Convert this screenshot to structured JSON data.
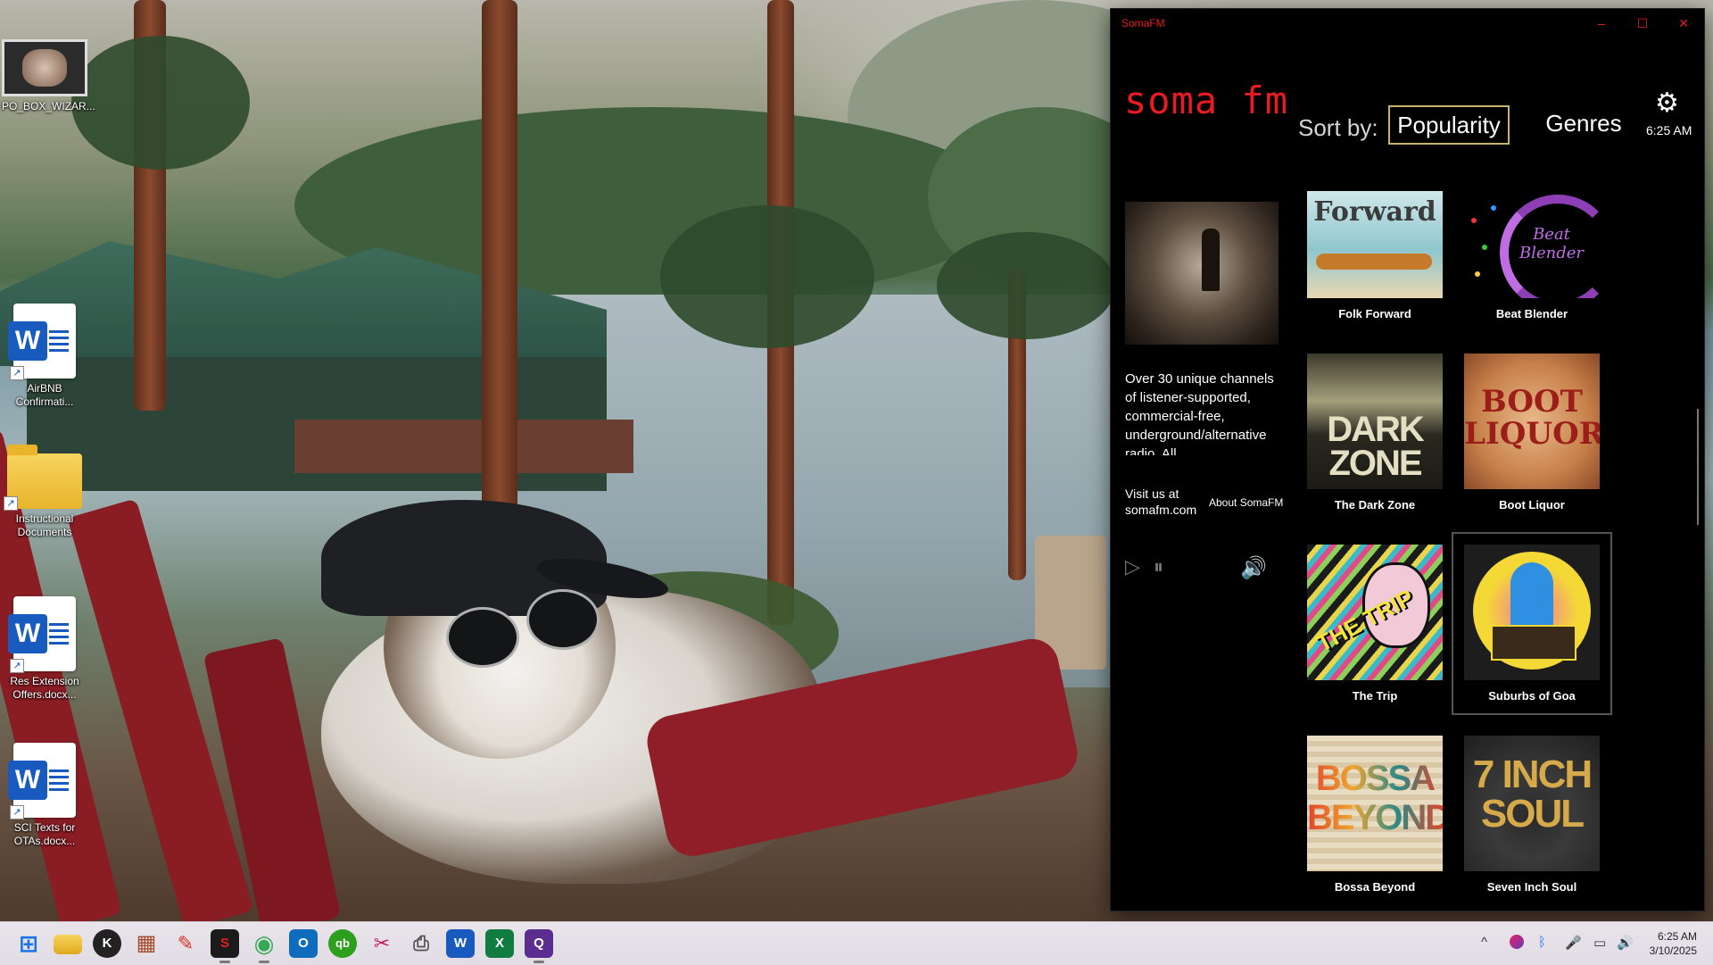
{
  "desktop": {
    "icons": [
      {
        "label": "PO_BOX_WIZAR..."
      },
      {
        "label": "AirBNB Confirmati..."
      },
      {
        "label": "Instructional Documents"
      },
      {
        "label": "Res Extension Offers.docx..."
      },
      {
        "label": "SCI Texts for OTAs.docx..."
      }
    ]
  },
  "window": {
    "title": "SomaFM",
    "controls": {
      "minimize": "–",
      "maximize": "☐",
      "close": "✕"
    }
  },
  "app": {
    "logo": "soma fm",
    "sort_label": "Sort by:",
    "sort_options": [
      "Popularity",
      "Genres"
    ],
    "selected_sort": "Popularity",
    "time": "6:25 AM",
    "description": "Over 30 unique channels of listener-supported, commercial-free, underground/alternative radio. All",
    "visit_text": "Visit us at somafm.com",
    "about_link": "About SomaFM",
    "icons": {
      "settings": "⚙",
      "play": "▷",
      "pause": "⏸",
      "volume": "🔊"
    }
  },
  "channels": [
    {
      "name": "Folk Forward",
      "art_text": "Forward"
    },
    {
      "name": "Beat Blender",
      "art_text": "Beat Blender"
    },
    {
      "name": "The Dark Zone",
      "art_text": "DARK ZONE"
    },
    {
      "name": "Boot Liquor",
      "art_text": "BOOT LIQUOR"
    },
    {
      "name": "The Trip",
      "art_text": "THE TRIP"
    },
    {
      "name": "Suburbs of Goa",
      "art_text": ""
    },
    {
      "name": "Bossa Beyond",
      "art_text": "BOSSA BEYOND"
    },
    {
      "name": "Seven Inch Soul",
      "art_text": "7 INCH SOUL"
    }
  ],
  "selected_channel": "Suburbs of Goa",
  "taskbar": {
    "apps": [
      {
        "icon": "windows-start-icon",
        "glyph": "⊞"
      },
      {
        "icon": "file-explorer-icon",
        "glyph": ""
      },
      {
        "icon": "k-app-icon",
        "glyph": "K"
      },
      {
        "icon": "grid-app-icon",
        "glyph": "▦"
      },
      {
        "icon": "notes-app-icon",
        "glyph": "✎"
      },
      {
        "icon": "somafm-app-icon",
        "glyph": "S"
      },
      {
        "icon": "chrome-icon",
        "glyph": "◉"
      },
      {
        "icon": "outlook-icon",
        "glyph": "O"
      },
      {
        "icon": "quickbooks-icon",
        "glyph": "qb"
      },
      {
        "icon": "snipping-tool-icon",
        "glyph": "✂"
      },
      {
        "icon": "printer-app-icon",
        "glyph": "⎙"
      },
      {
        "icon": "word-icon",
        "glyph": "W"
      },
      {
        "icon": "excel-icon",
        "glyph": "X"
      },
      {
        "icon": "app-icon",
        "glyph": "Q"
      }
    ],
    "tray": {
      "chevron": "^",
      "mic": "🎤",
      "bluetooth": "ᛒ",
      "network": "▭",
      "volume": "🔊"
    },
    "time": "6:25 AM",
    "date": "3/10/2025"
  }
}
